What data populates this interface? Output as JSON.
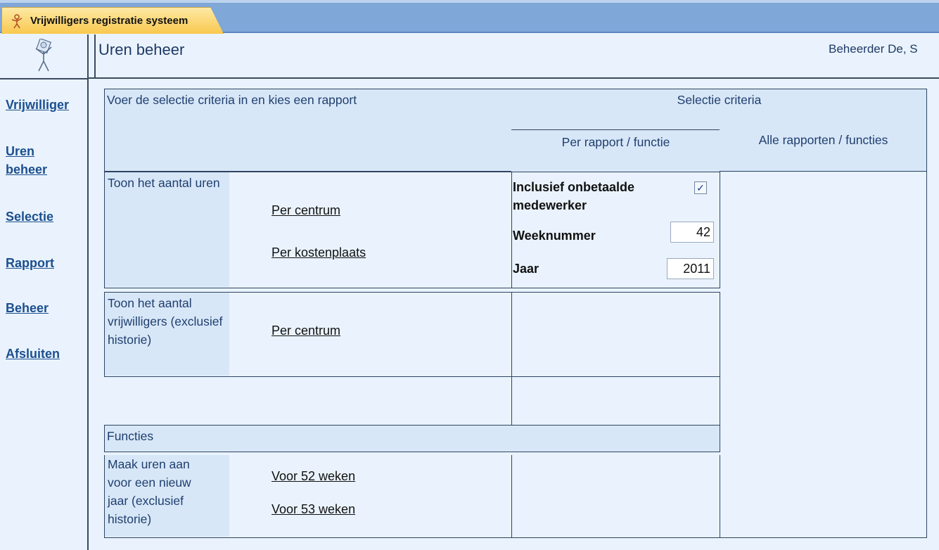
{
  "app": {
    "tab_title": "Vrijwilligers registratie systeem"
  },
  "header": {
    "page_title": "Uren beheer",
    "user": "Beheerder De, S"
  },
  "sidebar": {
    "items": [
      {
        "label": "Vrijwilliger"
      },
      {
        "label": "Uren beheer"
      },
      {
        "label": "Selectie"
      },
      {
        "label": "Rapport"
      },
      {
        "label": "Beheer"
      },
      {
        "label": "Afsluiten"
      }
    ]
  },
  "main": {
    "instruction": "Voer de selectie criteria in en kies een rapport",
    "criteria_header": "Selectie criteria",
    "per_report_header": "Per rapport / functie",
    "all_reports_header": "Alle rapporten / functies",
    "section_uren": {
      "label": "Toon het aantal uren",
      "links": [
        "Per centrum",
        "Per kostenplaats"
      ]
    },
    "criteria": {
      "unpaid_label": "Inclusief onbetaalde medewerker",
      "unpaid_checked": true,
      "week_label": "Weeknummer",
      "week_value": "42",
      "year_label": "Jaar",
      "year_value": "2011"
    },
    "section_vrijwilligers": {
      "label": "Toon het aantal vrijwilligers (exclusief historie)",
      "links": [
        "Per centrum"
      ]
    },
    "functions_header": "Functies",
    "section_new_year": {
      "label": "Maak uren aan voor een nieuw jaar (exclusief historie)",
      "links": [
        "Voor 52 weken",
        "Voor 53 weken"
      ]
    }
  }
}
